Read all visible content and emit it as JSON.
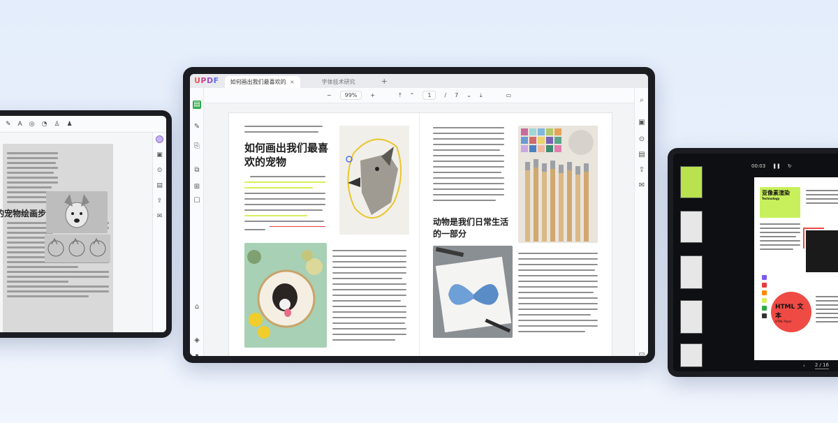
{
  "app": {
    "logo": "UPDF"
  },
  "tabs": [
    {
      "label": "如何画出我们最喜欢的宠物",
      "close": "×"
    },
    {
      "label": "字体技术研究"
    }
  ],
  "toolbar": {
    "zoom": "99%",
    "page_current": "1",
    "page_sep": "/",
    "page_total": "7",
    "zoom_out": "−",
    "zoom_in": "+"
  },
  "document": {
    "title": "如何画出我们最喜欢的宠物",
    "title_line1": "如何画出我们最喜",
    "title_line2": "欢的宠物",
    "section_title_line1": "动物是我们日常生活",
    "section_title_line2": "的一部分"
  },
  "left_device": {
    "heading": "可爱的宠物绘画步骤"
  },
  "right_device": {
    "time": "00:03",
    "slide_green_title": "亚像素渲染",
    "slide_green_sub": "Technology",
    "slide_red_title": "HTML 文本",
    "slide_red_sub": "HTML Paper",
    "page_indicator": "2 / 16",
    "prev": "‹",
    "next": "›",
    "swatches": [
      "#7b5cf0",
      "#e53d3d",
      "#ff8a00",
      "#d6f05a",
      "#2fa84a",
      "#333333"
    ]
  }
}
